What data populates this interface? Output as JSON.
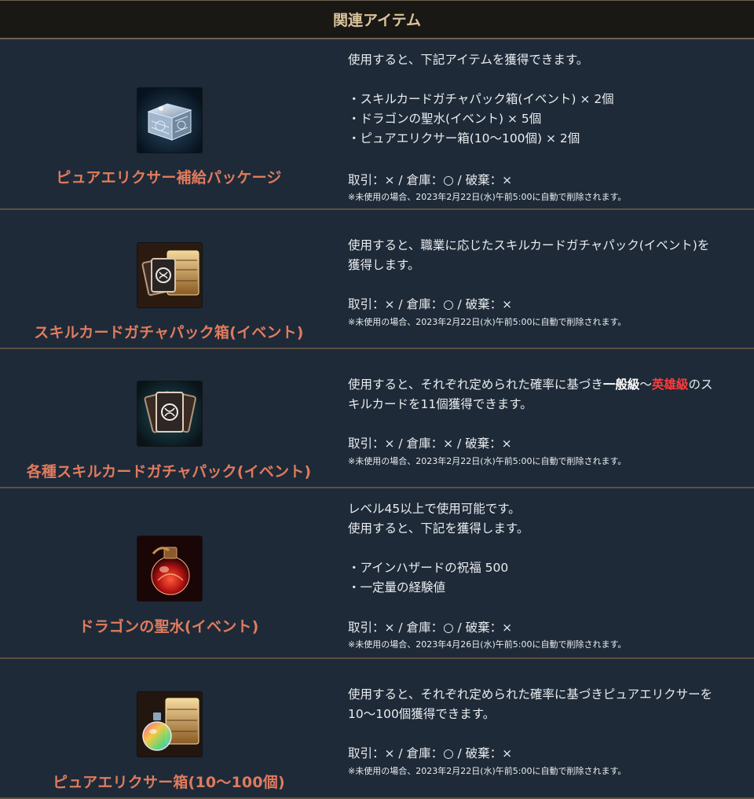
{
  "header": {
    "title": "関連アイテム"
  },
  "items": [
    {
      "name": "ピュアエリクサー補給パッケージ",
      "icon": "silver-chest-icon",
      "desc": [
        "使用すると、下記アイテムを獲得できます。",
        "",
        "・スキルカードガチャパック箱(イベント) × 2個",
        "・ドラゴンの聖水(イベント) × 5個",
        "・ピュアエリクサー箱(10～100個) × 2個"
      ],
      "trade": "取引：× / 倉庫：○ / 破棄：×",
      "note": "※未使用の場合、2023年2月22日(水)午前5:00に自動で削除されます。"
    },
    {
      "name": "スキルカードガチャパック箱(イベント)",
      "icon": "card-chest-icon",
      "desc": [
        "使用すると、職業に応じたスキルカードガチャパック(イベント)を",
        "獲得します。"
      ],
      "trade": "取引：× / 倉庫：○ / 破棄：×",
      "note": "※未使用の場合、2023年2月22日(水)午前5:00に自動で削除されます。"
    },
    {
      "name": "各種スキルカードガチャパック(イベント)",
      "icon": "skill-cards-icon",
      "desc_parts": {
        "a": "使用すると、それぞれ定められた確率に基づき",
        "b": "一般級",
        "c": "～",
        "d": "英雄級",
        "e": "のス",
        "f": "キルカードを11個獲得できます。"
      },
      "trade": "取引：× / 倉庫：× / 破棄：×",
      "note": "※未使用の場合、2023年2月22日(水)午前5:00に自動で削除されます。"
    },
    {
      "name": "ドラゴンの聖水(イベント)",
      "icon": "red-potion-icon",
      "desc": [
        "レベル45以上で使用可能です。",
        "使用すると、下記を獲得します。",
        "",
        "・アインハザードの祝福 500",
        "・一定量の経験値"
      ],
      "trade": "取引：× / 倉庫：○ / 破棄：×",
      "note": "※未使用の場合、2023年4月26日(水)午前5:00に自動で削除されます。"
    },
    {
      "name": "ピュアエリクサー箱(10～100個)",
      "icon": "elixir-chest-icon",
      "desc": [
        "使用すると、それぞれ定められた確率に基づきピュアエリクサーを",
        "10～100個獲得できます。"
      ],
      "trade": "取引：× / 倉庫：○ / 破棄：×",
      "note": "※未使用の場合、2023年2月22日(水)午前5:00に自動で削除されます。"
    }
  ],
  "colors": {
    "background": "#1e2a38",
    "header_bg": "#1a1815",
    "header_text": "#d9c39a",
    "item_name": "#e07b5e",
    "divider": "#5e4f42",
    "highlight_red": "#ff3b3b"
  }
}
